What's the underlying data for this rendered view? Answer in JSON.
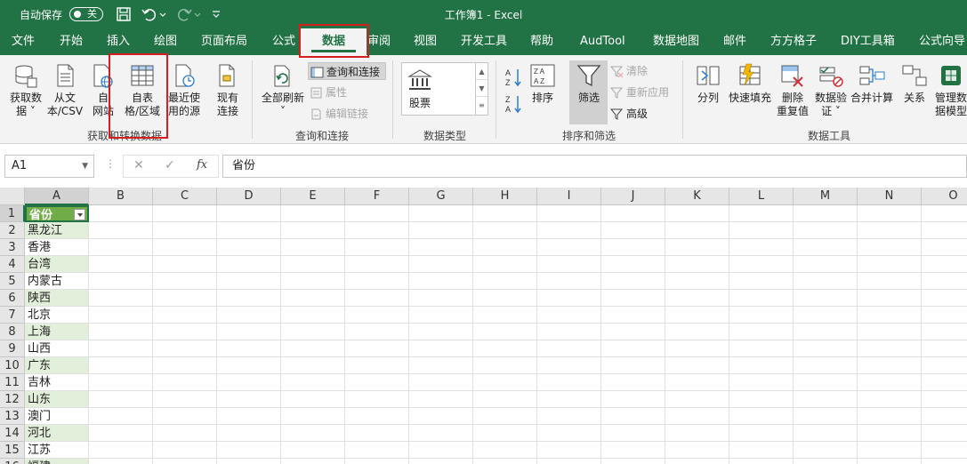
{
  "titlebar": {
    "autosave_label": "自动保存",
    "toggle_text": "关",
    "doc_title": "工作簿1 - Excel"
  },
  "tabs": [
    {
      "label": "文件"
    },
    {
      "label": "开始"
    },
    {
      "label": "插入"
    },
    {
      "label": "绘图"
    },
    {
      "label": "页面布局"
    },
    {
      "label": "公式"
    },
    {
      "label": "数据",
      "active": true
    },
    {
      "label": "审阅"
    },
    {
      "label": "视图"
    },
    {
      "label": "开发工具"
    },
    {
      "label": "帮助"
    },
    {
      "label": "AudTool"
    },
    {
      "label": "数据地图"
    },
    {
      "label": "邮件"
    },
    {
      "label": "方方格子"
    },
    {
      "label": "DIY工具箱"
    },
    {
      "label": "公式向导"
    }
  ],
  "ribbon": {
    "get_data": {
      "line1": "获取数",
      "line2": "据 ˅"
    },
    "from_text": {
      "line1": "从文",
      "line2": "本/CSV"
    },
    "from_web": {
      "line1": "自",
      "line2": "网站"
    },
    "from_table": {
      "line1": "自表",
      "line2": "格/区域"
    },
    "recent_sources": {
      "line1": "最近使",
      "line2": "用的源"
    },
    "existing_conn": {
      "line1": "现有",
      "line2": "连接"
    },
    "group_get_transform": "获取和转换数据",
    "refresh_all": {
      "line1": "全部刷新",
      "line2": "˅"
    },
    "queries_connections": "查询和连接",
    "properties": "属性",
    "edit_links": "编辑链接",
    "group_queries": "查询和连接",
    "stock": "股票",
    "group_data_types": "数据类型",
    "sort_label": "排序",
    "filter_label": "筛选",
    "clear": "清除",
    "reapply": "重新应用",
    "advanced": "高级",
    "group_sort_filter": "排序和筛选",
    "split": "分列",
    "flash_fill": "快速填充",
    "remove_dup": {
      "line1": "删除",
      "line2": "重复值"
    },
    "validation": {
      "line1": "数据验",
      "line2": "证 ˅"
    },
    "consolidate": "合并计算",
    "relations": "关系",
    "manage_model": {
      "line1": "管理数",
      "line2": "据模型"
    },
    "group_data_tools": "数据工具"
  },
  "formula_bar": {
    "name_box": "A1",
    "cancel": "✕",
    "enter": "✓",
    "fx": "fx",
    "value": "省份"
  },
  "columns": [
    "A",
    "B",
    "C",
    "D",
    "E",
    "F",
    "G",
    "H",
    "I",
    "J",
    "K",
    "L",
    "M",
    "N",
    "O"
  ],
  "rows": [
    "1",
    "2",
    "3",
    "4",
    "5",
    "6",
    "7",
    "8",
    "9",
    "10",
    "11",
    "12",
    "13",
    "14",
    "15",
    "16"
  ],
  "column_a": [
    "省份",
    "黑龙江",
    "香港",
    "台湾",
    "内蒙古",
    "陕西",
    "北京",
    "上海",
    "山西",
    "广东",
    "吉林",
    "山东",
    "澳门",
    "河北",
    "江苏",
    "福建"
  ]
}
